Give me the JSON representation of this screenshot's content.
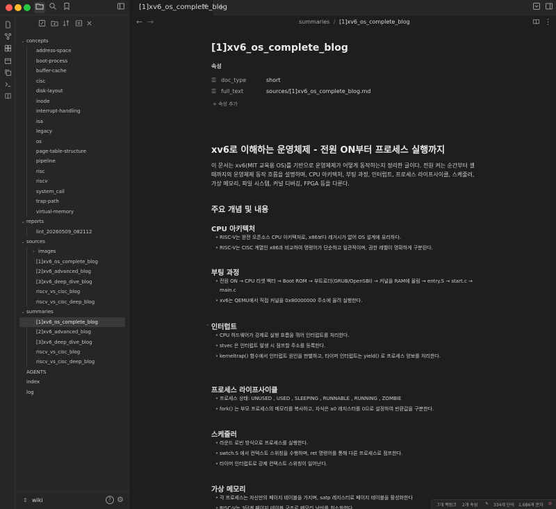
{
  "window": {
    "traffic_colors": [
      "#ff5f57",
      "#febc2e",
      "#28c840"
    ],
    "tab_title": "[1]xv6_os_complete_blog"
  },
  "icons": {
    "titlebar": [
      "folder-icon",
      "search-icon",
      "bookmark-icon",
      "sidebar-toggle-icon"
    ],
    "ribbon": [
      "file-icon",
      "graph-icon",
      "canvas-icon",
      "calendar-icon",
      "copy-icon",
      "terminal-icon",
      "book-icon"
    ],
    "sidebar_tools": [
      "new-note-icon",
      "new-folder-icon",
      "sort-icon",
      "collapse-icon",
      "close-icon"
    ]
  },
  "sidebar": {
    "tree": [
      {
        "label": "concepts",
        "type": "folder",
        "level": 0
      },
      {
        "label": "address-space",
        "type": "file",
        "level": 1
      },
      {
        "label": "boot-process",
        "type": "file",
        "level": 1
      },
      {
        "label": "buffer-cache",
        "type": "file",
        "level": 1
      },
      {
        "label": "cisc",
        "type": "file",
        "level": 1
      },
      {
        "label": "disk-layout",
        "type": "file",
        "level": 1
      },
      {
        "label": "inode",
        "type": "file",
        "level": 1
      },
      {
        "label": "interrupt-handling",
        "type": "file",
        "level": 1
      },
      {
        "label": "isa",
        "type": "file",
        "level": 1
      },
      {
        "label": "legacy",
        "type": "file",
        "level": 1
      },
      {
        "label": "os",
        "type": "file",
        "level": 1
      },
      {
        "label": "page-table-structure",
        "type": "file",
        "level": 1
      },
      {
        "label": "pipeline",
        "type": "file",
        "level": 1
      },
      {
        "label": "risc",
        "type": "file",
        "level": 1
      },
      {
        "label": "riscv",
        "type": "file",
        "level": 1
      },
      {
        "label": "system_call",
        "type": "file",
        "level": 1
      },
      {
        "label": "trap-path",
        "type": "file",
        "level": 1
      },
      {
        "label": "virtual-memory",
        "type": "file",
        "level": 1
      },
      {
        "label": "reports",
        "type": "folder",
        "level": 0
      },
      {
        "label": "lint_20260509_082112",
        "type": "file",
        "level": 1
      },
      {
        "label": "sources",
        "type": "folder",
        "level": 0
      },
      {
        "label": "images",
        "type": "folder-collapsed",
        "level": 1
      },
      {
        "label": "[1]xv6_os_complete_blog",
        "type": "file",
        "level": 1
      },
      {
        "label": "[2]xv6_advanced_blog",
        "type": "file",
        "level": 1
      },
      {
        "label": "[3]xv6_deep_dive_blog",
        "type": "file",
        "level": 1
      },
      {
        "label": "riscv_vs_cisc_blog",
        "type": "file",
        "level": 1
      },
      {
        "label": "riscv_vs_cisc_deep_blog",
        "type": "file",
        "level": 1
      },
      {
        "label": "summaries",
        "type": "folder",
        "level": 0
      },
      {
        "label": "[1]xv6_os_complete_blog",
        "type": "file",
        "level": 1,
        "selected": true
      },
      {
        "label": "[2]xv6_advanced_blog",
        "type": "file",
        "level": 1
      },
      {
        "label": "[3]xv6_deep_dive_blog",
        "type": "file",
        "level": 1
      },
      {
        "label": "riscv_vs_cisc_blog",
        "type": "file",
        "level": 1
      },
      {
        "label": "riscv_vs_cisc_deep_blog",
        "type": "file",
        "level": 1
      },
      {
        "label": "AGENTS",
        "type": "file",
        "level": 0
      },
      {
        "label": "index",
        "type": "file",
        "level": 0
      },
      {
        "label": "log",
        "type": "file",
        "level": 0
      }
    ],
    "vault_name": "wiki"
  },
  "main": {
    "breadcrumb_parent": "summaries",
    "breadcrumb_sep": "/",
    "breadcrumb_current": "[1]xv6_os_complete_blog",
    "title": "[1]xv6_os_complete_blog",
    "properties_heading": "속성",
    "properties": [
      {
        "key": "doc_type",
        "value": "short",
        "icon": "list-icon"
      },
      {
        "key": "full_text",
        "value": "sources/[1]xv6_os_complete_blog.md",
        "icon": "list-icon"
      }
    ],
    "add_property": "속성 추가",
    "h1": "xv6로 이해하는 운영체제 - 전원 ON부터 프로세스 실행까지",
    "intro": "이 문서는 xv6(MIT 교육용 OS)를 기반으로 운영체제가 어떻게 동작하는지 정리한 글이다. 전원 켜는 순간부터 셸 때까지의 운영체제 동작 흐름을 설명하며, CPU 아키텍처, 부팅 과정, 인터럽트, 프로세스 라이프사이클, 스케줄러, 가상 메모리, 파일 시스템, 커널 디버깅, FPGA 등을 다룬다.",
    "h2": "주요 개념 및 내용",
    "sections": [
      {
        "heading": "CPU 아키텍처",
        "bullets": [
          "RISC-V는 완전 오픈소스 CPU 아키텍처로, x86보다 레거시가 없어 OS 설계에 유리하다.",
          "RISC-V는 CISC 계열인 x86과 비교하여 명령어가 단순하고 일관적이며, 권한 레벨이 명확하게 구분된다."
        ]
      },
      {
        "heading": "부팅 과정",
        "bullets": [
          "전원 ON → CPU 리셋 벡터 → Boot ROM → 부트로더(GRUB/OpenSBI) → 커널을 RAM에 올림 → entry.S → start.c → main.c",
          "xv6는 QEMU에서 직접 커널을 0x80000000 주소에 올려 실행한다."
        ]
      },
      {
        "heading": "인터럽트",
        "bullets": [
          "CPU 하드웨어가 강제로 실행 흐름을 꺾어 인터럽트를 처리한다.",
          "stvec 은 인터럽트 발생 시 점프할 주소를 등록한다.",
          "kerneltrap() 함수에서 인터럽트 원인을 판별하고, 타이머 인터럽트는 yield() 로 프로세스 양보를 처리한다."
        ]
      },
      {
        "heading": "프로세스 라이프사이클",
        "bullets": [
          "프로세스 상태: UNUSED , USED , SLEEPING , RUNNABLE , RUNNING , ZOMBIE",
          "fork() 는 부모 프로세스의 메모리를 복사하고, 자식은 a0 레지스터를 0으로 설정하여 반환값을 구분한다."
        ]
      },
      {
        "heading": "스케줄러",
        "bullets": [
          "라운드 로빈 방식으로 프로세스를 실행한다.",
          "swtch.S 에서 컨텍스트 스위칭을 수행하며, ret 명령어를 통해 다른 프로세스로 점프한다.",
          "타이머 인터럽트로 강제 컨텍스트 스위칭이 일어난다."
        ]
      },
      {
        "heading": "가상 메모리",
        "bullets": [
          "각 프로세스는 자신만의 페이지 테이블을 가지며, satp 레지스터로 페이지 테이블을 활성화한다",
          "RISC-V는 3단계 페이지 테이블 구조로 메모리 낭비를 최소화한다."
        ]
      }
    ]
  },
  "status": {
    "backlinks": "7개 백링크",
    "properties_count": "2개 속성",
    "words": "334개 단어",
    "chars": "1,686개 문자"
  }
}
